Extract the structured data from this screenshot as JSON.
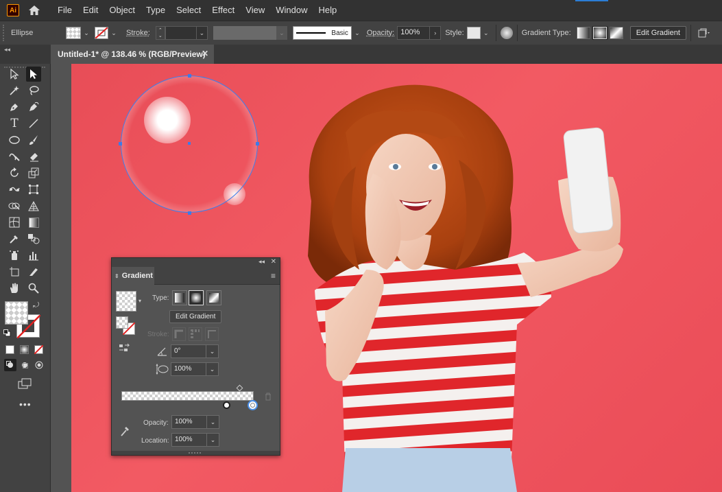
{
  "app": {
    "logo_text": "Ai"
  },
  "menu": {
    "items": [
      "File",
      "Edit",
      "Object",
      "Type",
      "Select",
      "Effect",
      "View",
      "Window",
      "Help"
    ]
  },
  "control_bar": {
    "object_type": "Ellipse",
    "stroke_label": "Stroke:",
    "brush_label": "Basic",
    "opacity_label": "Opacity:",
    "opacity_value": "100%",
    "style_label": "Style:",
    "gradient_type_label": "Gradient Type:",
    "edit_gradient_label": "Edit Gradient"
  },
  "document_tab": {
    "title": "Untitled-1* @ 138.46 % (RGB/Preview)",
    "close": "✕"
  },
  "gradient_panel": {
    "title": "Gradient",
    "type_label": "Type:",
    "edit_gradient_label": "Edit Gradient",
    "stroke_label": "Stroke:",
    "angle_value": "0°",
    "aspect_value": "100%",
    "opacity_label": "Opacity:",
    "opacity_value": "100%",
    "location_label": "Location:",
    "location_value": "100%"
  },
  "colors": {
    "artboard": "#ee525c",
    "accent": "#2b7dd6"
  }
}
